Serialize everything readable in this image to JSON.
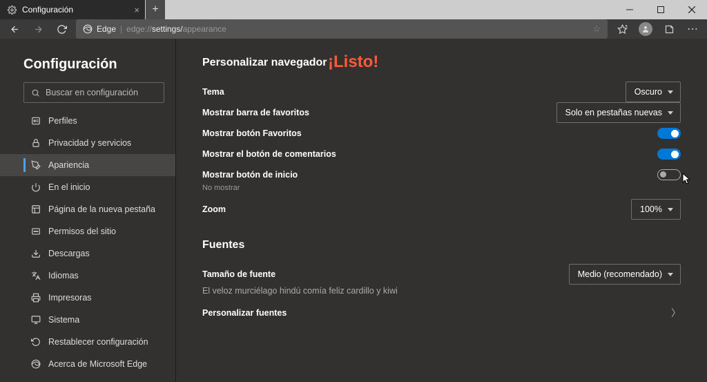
{
  "titlebar": {
    "tab_title": "Configuración"
  },
  "toolbar": {
    "edge_label": "Edge",
    "url_prefix": "edge://",
    "url_mid": "settings/",
    "url_tail": "appearance"
  },
  "overlay": {
    "listo": "¡Listo!"
  },
  "sidebar": {
    "heading": "Configuración",
    "search_placeholder": "Buscar en configuración",
    "items": {
      "profiles": "Perfiles",
      "privacy": "Privacidad y servicios",
      "appearance": "Apariencia",
      "onstart": "En el inicio",
      "newtab": "Página de la nueva pestaña",
      "siteperm": "Permisos del sitio",
      "downloads": "Descargas",
      "languages": "Idiomas",
      "printers": "Impresoras",
      "system": "Sistema",
      "reset": "Restablecer configuración",
      "about": "Acerca de Microsoft Edge"
    }
  },
  "main": {
    "section1_title": "Personalizar navegador",
    "theme_label": "Tema",
    "theme_value": "Oscuro",
    "favbar_label": "Mostrar barra de favoritos",
    "favbar_value": "Solo en pestañas nuevas",
    "favbtn_label": "Mostrar botón Favoritos",
    "feedback_label": "Mostrar el botón de comentarios",
    "homebtn_label": "Mostrar botón de inicio",
    "homebtn_sub": "No mostrar",
    "zoom_label": "Zoom",
    "zoom_value": "100%",
    "section2_title": "Fuentes",
    "fontsize_label": "Tamaño de fuente",
    "fontsize_value": "Medio (recomendado)",
    "fontsample": "El veloz murciélago hindú comía feliz cardillo y kiwi",
    "customfonts": "Personalizar fuentes"
  }
}
